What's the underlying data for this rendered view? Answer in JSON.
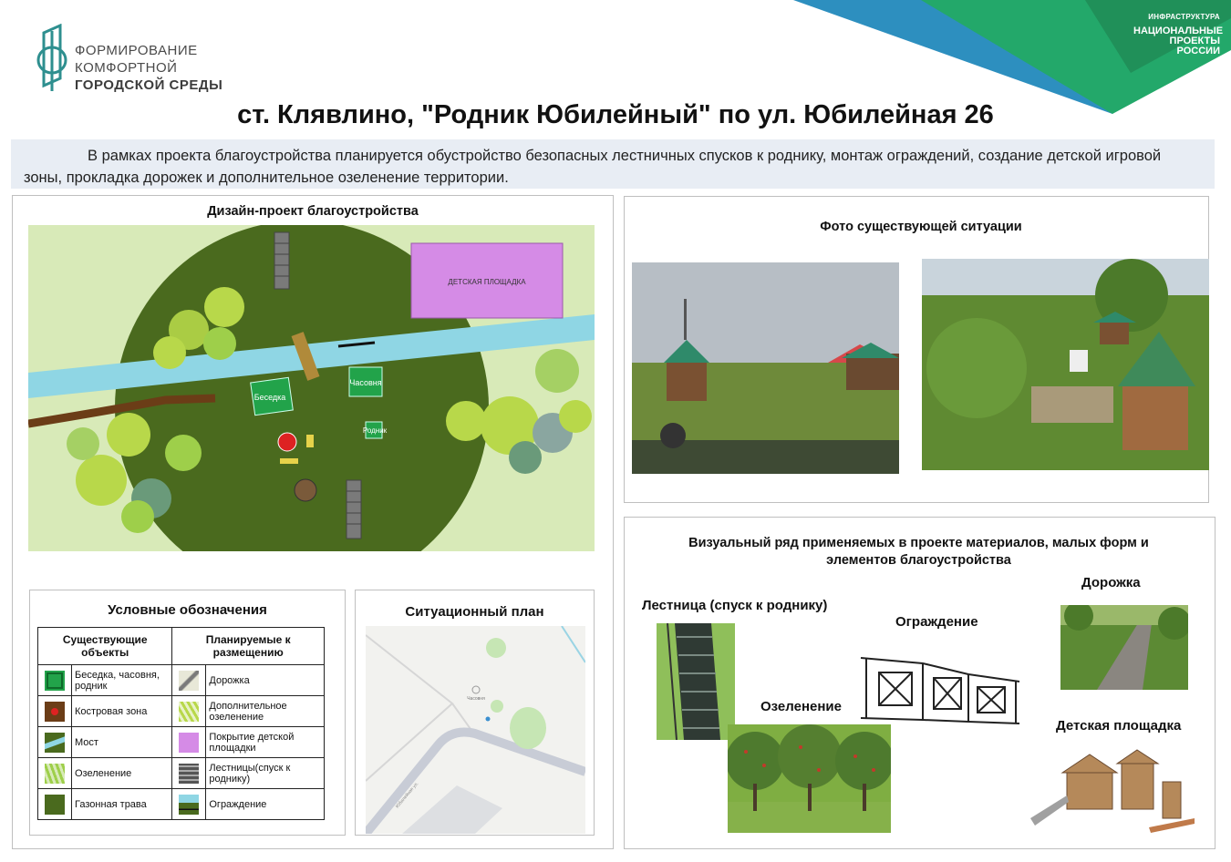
{
  "header": {
    "logo_lines": [
      "ФОРМИРОВАНИЕ",
      "КОМФОРТНОЙ",
      "ГОРОДСКОЙ СРЕДЫ"
    ],
    "np_badge": {
      "top": "ИНФРАСТРУКТУРА",
      "lines": [
        "НАЦИОНАЛЬНЫЕ",
        "ПРОЕКТЫ",
        "РОССИИ"
      ]
    },
    "title": "ст. Клявлино, \"Родник Юбилейный\" по ул. Юбилейная 26"
  },
  "intro": "В рамках проекта благоустройства планируется обустройство безопасных лестничных спусков к роднику, монтаж ограждений, создание детской игровой зоны, прокладка дорожек и дополнительное озеленение территории.",
  "design": {
    "title": "Дизайн-проект благоустройства",
    "labels": {
      "playground": "ДЕТСКАЯ ПЛОЩАДКА",
      "gazebo": "Беседка",
      "chapel": "Часовня",
      "spring": "Родник"
    }
  },
  "legend": {
    "title": "Условные обозначения",
    "head_existing": "Существующие объекты",
    "head_planned": "Планируемые к размещению",
    "rows": [
      {
        "existing": "Беседка, часовня, родник",
        "planned": "Дорожка"
      },
      {
        "existing": "Костровая зона",
        "planned": "Дополнительное озеленение"
      },
      {
        "existing": "Мост",
        "planned": "Покрытие детской площадки"
      },
      {
        "existing": "Озеленение",
        "planned": "Лестницы(спуск к роднику)"
      },
      {
        "existing": "Газонная трава",
        "planned": "Ограждение"
      }
    ]
  },
  "situation": {
    "title": "Ситуационный план",
    "map_label": "Часовня",
    "street_label": "Юбилейная ул."
  },
  "photos": {
    "title": "Фото существующей ситуации"
  },
  "materials": {
    "title": "Визуальный ряд применяемых в проекте материалов, малых форм и элементов благоустройства",
    "items": {
      "stairs": "Лестница (спуск к роднику)",
      "fence": "Ограждение",
      "path": "Дорожка",
      "greening": "Озеленение",
      "playground": "Детская площадка"
    }
  },
  "colors": {
    "brand_teal": "#2e8f8f",
    "lawn": "#4a6a1e",
    "ground": "#d8eab8",
    "stream": "#8fd6e4",
    "playground": "#d58be6",
    "np_green": "#1e9a58",
    "np_blue": "#2d8fbf"
  }
}
